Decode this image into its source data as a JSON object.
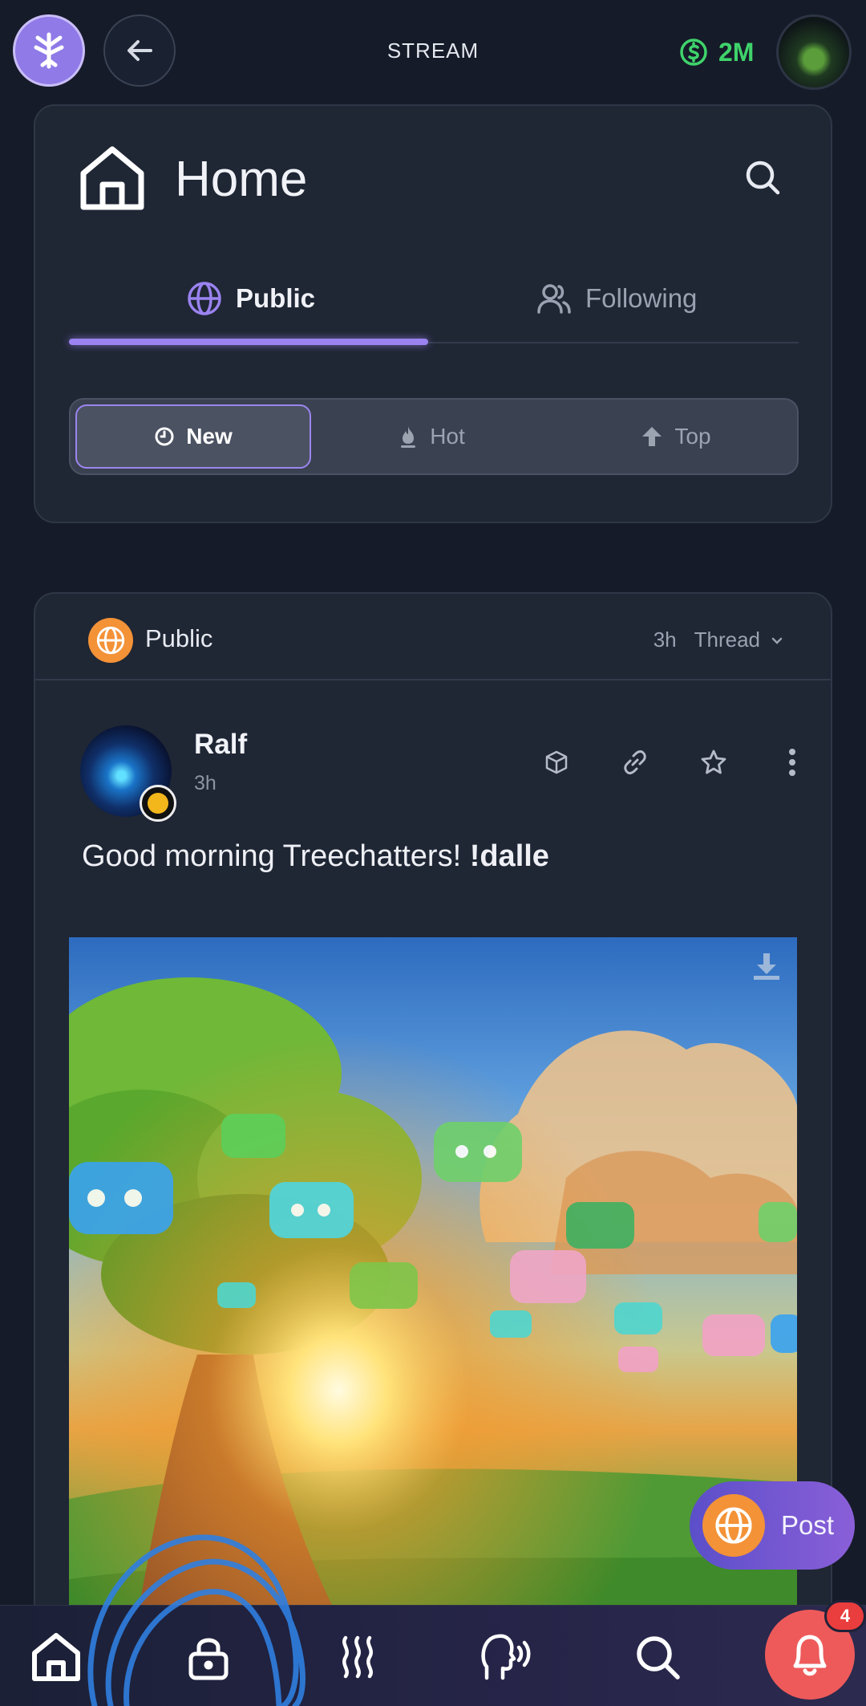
{
  "topbar": {
    "title": "STREAM",
    "balance": "2M",
    "balance_icon": "dollar-circle-icon",
    "logo_icon": "hive-logo-icon",
    "back_icon": "arrow-left-icon",
    "colors": {
      "balance": "#3fd36b",
      "logo_bg": "#8f7ae8"
    }
  },
  "home": {
    "title": "Home",
    "tabs": [
      {
        "label": "Public",
        "icon": "globe-icon",
        "active": true
      },
      {
        "label": "Following",
        "icon": "users-icon",
        "active": false
      }
    ],
    "sort": [
      {
        "label": "New",
        "icon": "clock-icon",
        "active": true
      },
      {
        "label": "Hot",
        "icon": "flame-icon",
        "active": false
      },
      {
        "label": "Top",
        "icon": "arrow-up-icon",
        "active": false
      }
    ],
    "accent": "#9a83f0"
  },
  "post": {
    "scope": "Public",
    "age": "3h",
    "view_mode": "Thread",
    "author": {
      "name": "Ralf",
      "time": "3h"
    },
    "text_plain": "Good morning Treechatters! ",
    "text_bold": "!dalle",
    "actions": [
      "cube-icon",
      "link-icon",
      "star-icon",
      "more-vertical-icon"
    ]
  },
  "fab": {
    "label": "Post",
    "icon": "globe-icon"
  },
  "bottom_nav": {
    "items": [
      "home-icon",
      "lock-icon",
      "waves-icon",
      "head-sound-icon",
      "search-icon"
    ],
    "notifications_count": "4",
    "notification_color": "#ee5a5a"
  }
}
